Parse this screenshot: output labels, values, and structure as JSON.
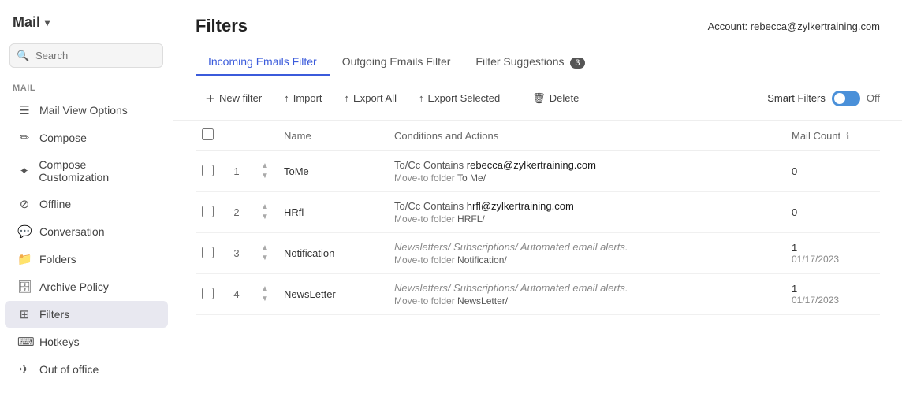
{
  "sidebar": {
    "logo": "Mail",
    "logo_chevron": "▾",
    "search_placeholder": "Search",
    "section_label": "MAIL",
    "items": [
      {
        "id": "mail-view-options",
        "label": "Mail View Options",
        "icon": "☰"
      },
      {
        "id": "compose",
        "label": "Compose",
        "icon": "✏"
      },
      {
        "id": "compose-customization",
        "label": "Compose Customization",
        "icon": "✦"
      },
      {
        "id": "offline",
        "label": "Offline",
        "icon": "⊘"
      },
      {
        "id": "conversation",
        "label": "Conversation",
        "icon": "💬"
      },
      {
        "id": "folders",
        "label": "Folders",
        "icon": "📁"
      },
      {
        "id": "archive-policy",
        "label": "Archive Policy",
        "icon": "🗄"
      },
      {
        "id": "filters",
        "label": "Filters",
        "icon": "⊞",
        "active": true
      },
      {
        "id": "hotkeys",
        "label": "Hotkeys",
        "icon": "⌨"
      },
      {
        "id": "out-of-office",
        "label": "Out of office",
        "icon": "✈"
      }
    ]
  },
  "header": {
    "title": "Filters",
    "account_label": "Account:",
    "account_value": "rebecca@zylkertraining.com"
  },
  "tabs": [
    {
      "id": "incoming",
      "label": "Incoming Emails Filter",
      "active": true
    },
    {
      "id": "outgoing",
      "label": "Outgoing Emails Filter",
      "active": false
    },
    {
      "id": "suggestions",
      "label": "Filter Suggestions",
      "badge": "3",
      "active": false
    }
  ],
  "toolbar": {
    "new_filter": "New filter",
    "import": "Import",
    "export_all": "Export All",
    "export_selected": "Export Selected",
    "delete": "Delete",
    "smart_filters": "Smart Filters",
    "off_label": "Off"
  },
  "table": {
    "columns": {
      "check": "",
      "num": "",
      "order": "",
      "name": "Name",
      "conditions": "Conditions and Actions",
      "count": "Mail Count"
    },
    "rows": [
      {
        "id": 1,
        "name": "ToMe",
        "cond_type": "To/Cc Contains",
        "cond_value": "rebecca@zylkertraining.com",
        "move_label": "Move-to folder",
        "move_folder": "To Me/",
        "italic": false,
        "count": "0",
        "date": ""
      },
      {
        "id": 2,
        "name": "HRfl",
        "cond_type": "To/Cc Contains",
        "cond_value": "hrfl@zylkertraining.com",
        "move_label": "Move-to folder",
        "move_folder": "HRFL/",
        "italic": false,
        "count": "0",
        "date": ""
      },
      {
        "id": 3,
        "name": "Notification",
        "cond_type": "Newsletters/ Subscriptions/ Automated email alerts.",
        "cond_value": "",
        "move_label": "Move-to folder",
        "move_folder": "Notification/",
        "italic": true,
        "count": "1",
        "date": "01/17/2023"
      },
      {
        "id": 4,
        "name": "NewsLetter",
        "cond_type": "Newsletters/ Subscriptions/ Automated email alerts.",
        "cond_value": "",
        "move_label": "Move-to folder",
        "move_folder": "NewsLetter/",
        "italic": true,
        "count": "1",
        "date": "01/17/2023"
      }
    ]
  }
}
